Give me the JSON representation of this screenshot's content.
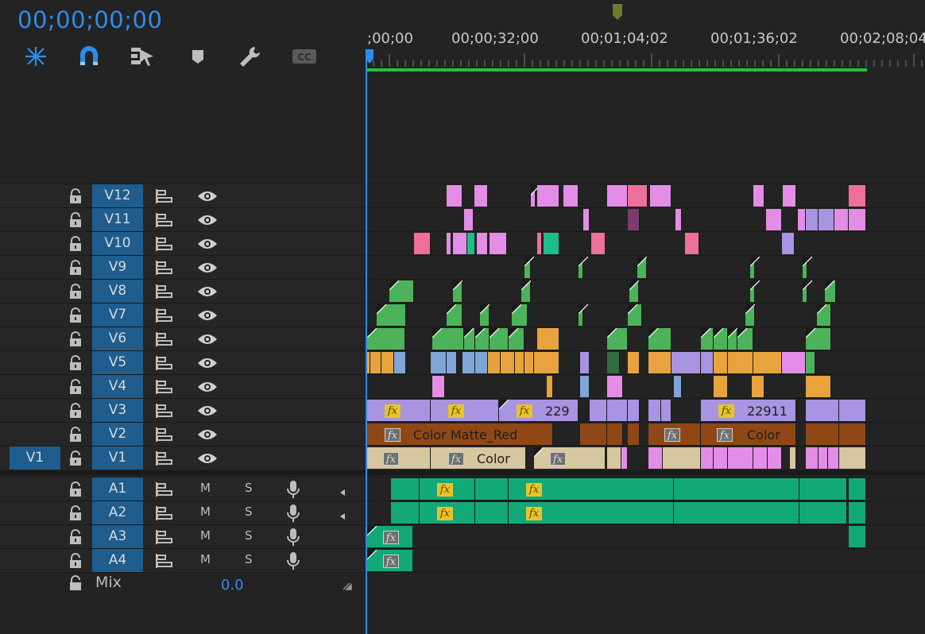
{
  "header": {
    "timecode": "00;00;00;00",
    "ruler": [
      ";00;00",
      "00;00;32;00",
      "00;01;04;02",
      "00;01;36;02",
      "00;02;08;04"
    ],
    "tools": [
      {
        "name": "ripple-snap-icon",
        "icon": "insert-icon"
      },
      {
        "name": "snap-icon",
        "icon": "magnet-icon"
      },
      {
        "name": "linked-selection-icon",
        "icon": "linked-selection-icon"
      },
      {
        "name": "add-marker-icon",
        "icon": "marker-icon"
      },
      {
        "name": "timeline-settings-icon",
        "icon": "wrench-icon"
      },
      {
        "name": "captions-icon",
        "icon": "cc-icon",
        "label": "CC"
      }
    ]
  },
  "tracks": {
    "video": [
      "V12",
      "V11",
      "V10",
      "V9",
      "V8",
      "V7",
      "V6",
      "V5",
      "V4",
      "V3",
      "V2",
      "V1"
    ],
    "audio": [
      "A1",
      "A2",
      "A3",
      "A4"
    ],
    "source_patch": "V1",
    "m_label": "M",
    "s_label": "S"
  },
  "mix": {
    "label": "Mix",
    "value": "0.0"
  },
  "clip_labels": {
    "v3_a": "229",
    "v3_b": "22911",
    "v2_a": "Color Matte_Red",
    "v2_b": "Color",
    "v1_a": "Color",
    "fx": "fx"
  },
  "colors": {
    "accent": "#2d8ceb",
    "track_label": "#1e5d8e",
    "pink": "#e38de6",
    "rose": "#ee6f9b",
    "green": "#4db35a",
    "orange": "#e8a33e",
    "blue": "#7fa6d6",
    "lavender": "#a894e0",
    "brown": "#8f4815",
    "tan": "#d6c7a0",
    "teal": "#1dbd8c",
    "audio": "#13a877"
  }
}
